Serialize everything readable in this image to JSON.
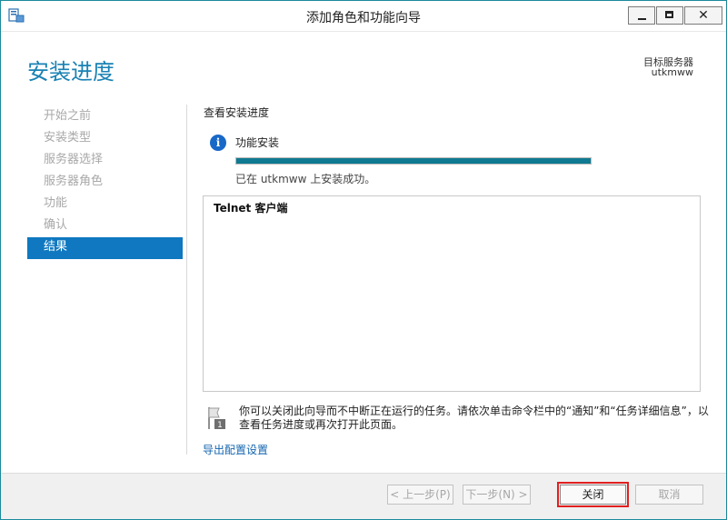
{
  "window": {
    "title": "添加角色和功能向导"
  },
  "header": {
    "page_title": "安装进度",
    "target_label": "目标服务器",
    "target_name": "utkmww"
  },
  "nav": {
    "items": [
      {
        "label": "开始之前"
      },
      {
        "label": "安装类型"
      },
      {
        "label": "服务器选择"
      },
      {
        "label": "服务器角色"
      },
      {
        "label": "功能"
      },
      {
        "label": "确认"
      },
      {
        "label": "结果"
      }
    ],
    "active_index": 6
  },
  "main": {
    "section_title": "查看安装进度",
    "status_label": "功能安装",
    "progress_percent": 100,
    "success_message": "已在 utkmww 上安装成功。",
    "results": [
      "Telnet 客户端"
    ],
    "note": "你可以关闭此向导而不中断正在运行的任务。请依次单击命令栏中的“通知”和“任务详细信息”，以查看任务进度或再次打开此页面。",
    "export_link": "导出配置设置"
  },
  "footer": {
    "prev_label": "< 上一步(P)",
    "next_label": "下一步(N) >",
    "close_label": "关闭",
    "cancel_label": "取消"
  },
  "colors": {
    "accent": "#0f78c0",
    "title_blue": "#1a82b4",
    "progress": "#0f7a92",
    "highlight": "#e02020"
  },
  "icons": {
    "app": "server-manager-icon",
    "info": "info-icon",
    "flag": "notification-flag-icon"
  }
}
